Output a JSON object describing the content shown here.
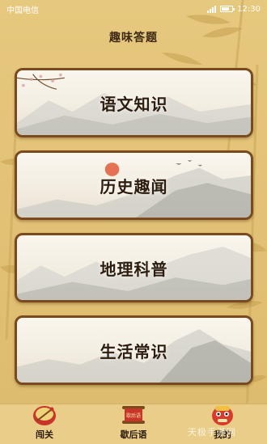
{
  "status_bar": {
    "carrier": "中国电信",
    "time": "12:30"
  },
  "page_title": "趣味答题",
  "cards": [
    {
      "label": "语文知识"
    },
    {
      "label": "历史趣闻"
    },
    {
      "label": "地理科普"
    },
    {
      "label": "生活常识"
    }
  ],
  "tabbar": {
    "tabs": [
      {
        "label": "闯关",
        "icon": "drum-icon",
        "active": true
      },
      {
        "label": "歇后语",
        "icon": "scroll-icon",
        "badge": "歇后语"
      },
      {
        "label": "我的",
        "icon": "lion-dance-icon"
      }
    ]
  },
  "watermark": "天极手游网",
  "colors": {
    "background": "#e2c277",
    "card_border": "#7a4a1e",
    "tabbar": "#e9cd88"
  }
}
